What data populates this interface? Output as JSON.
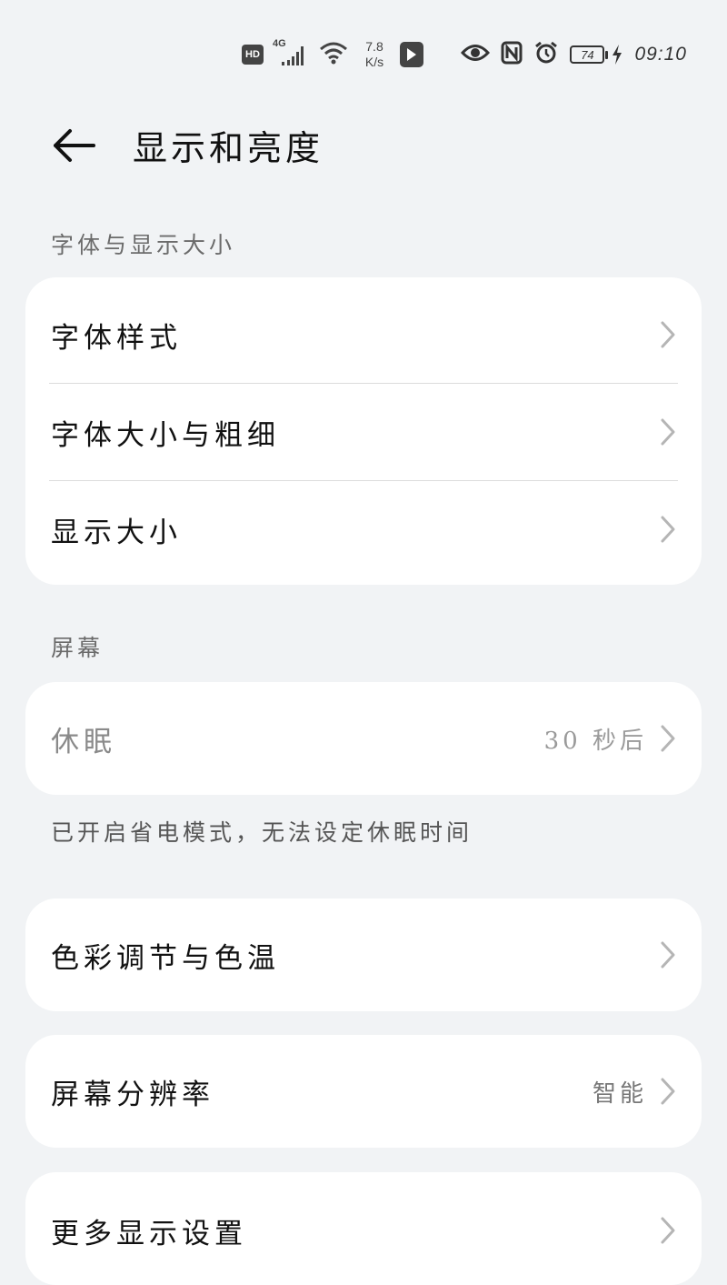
{
  "status_bar": {
    "hd": "HD",
    "network": "4G",
    "speed_value": "7.8",
    "speed_unit": "K/s",
    "battery": "74",
    "time": "09:10"
  },
  "header": {
    "title": "显示和亮度"
  },
  "sections": {
    "font_section_label": "字体与显示大小",
    "screen_section_label": "屏幕"
  },
  "font_card": {
    "items": [
      {
        "label": "字体样式"
      },
      {
        "label": "字体大小与粗细"
      },
      {
        "label": "显示大小"
      }
    ]
  },
  "sleep": {
    "label": "休眠",
    "value": "30 秒后",
    "note": "已开启省电模式，无法设定休眠时间"
  },
  "color": {
    "label": "色彩调节与色温"
  },
  "resolution": {
    "label": "屏幕分辨率",
    "value": "智能"
  },
  "more": {
    "label": "更多显示设置"
  },
  "colors": {
    "background": "#f1f3f5",
    "card": "#ffffff",
    "text_primary": "#111111",
    "text_secondary": "#6b6b6b",
    "divider": "#dcdcdc"
  }
}
